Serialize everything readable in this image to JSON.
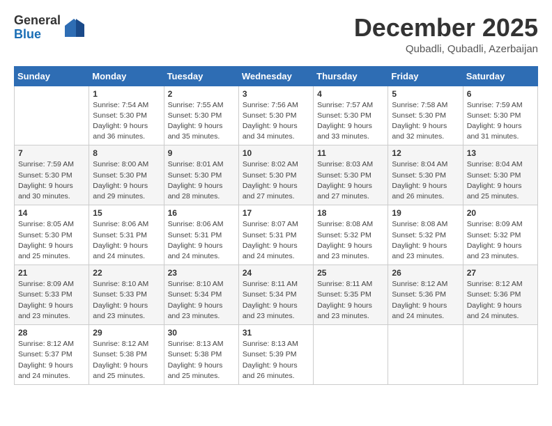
{
  "logo": {
    "general": "General",
    "blue": "Blue"
  },
  "title": {
    "month_year": "December 2025",
    "location": "Qubadli, Qubadli, Azerbaijan"
  },
  "headers": [
    "Sunday",
    "Monday",
    "Tuesday",
    "Wednesday",
    "Thursday",
    "Friday",
    "Saturday"
  ],
  "weeks": [
    [
      {
        "day": "",
        "sunrise": "",
        "sunset": "",
        "daylight": ""
      },
      {
        "day": "1",
        "sunrise": "Sunrise: 7:54 AM",
        "sunset": "Sunset: 5:30 PM",
        "daylight": "Daylight: 9 hours and 36 minutes."
      },
      {
        "day": "2",
        "sunrise": "Sunrise: 7:55 AM",
        "sunset": "Sunset: 5:30 PM",
        "daylight": "Daylight: 9 hours and 35 minutes."
      },
      {
        "day": "3",
        "sunrise": "Sunrise: 7:56 AM",
        "sunset": "Sunset: 5:30 PM",
        "daylight": "Daylight: 9 hours and 34 minutes."
      },
      {
        "day": "4",
        "sunrise": "Sunrise: 7:57 AM",
        "sunset": "Sunset: 5:30 PM",
        "daylight": "Daylight: 9 hours and 33 minutes."
      },
      {
        "day": "5",
        "sunrise": "Sunrise: 7:58 AM",
        "sunset": "Sunset: 5:30 PM",
        "daylight": "Daylight: 9 hours and 32 minutes."
      },
      {
        "day": "6",
        "sunrise": "Sunrise: 7:59 AM",
        "sunset": "Sunset: 5:30 PM",
        "daylight": "Daylight: 9 hours and 31 minutes."
      }
    ],
    [
      {
        "day": "7",
        "sunrise": "Sunrise: 7:59 AM",
        "sunset": "Sunset: 5:30 PM",
        "daylight": "Daylight: 9 hours and 30 minutes."
      },
      {
        "day": "8",
        "sunrise": "Sunrise: 8:00 AM",
        "sunset": "Sunset: 5:30 PM",
        "daylight": "Daylight: 9 hours and 29 minutes."
      },
      {
        "day": "9",
        "sunrise": "Sunrise: 8:01 AM",
        "sunset": "Sunset: 5:30 PM",
        "daylight": "Daylight: 9 hours and 28 minutes."
      },
      {
        "day": "10",
        "sunrise": "Sunrise: 8:02 AM",
        "sunset": "Sunset: 5:30 PM",
        "daylight": "Daylight: 9 hours and 27 minutes."
      },
      {
        "day": "11",
        "sunrise": "Sunrise: 8:03 AM",
        "sunset": "Sunset: 5:30 PM",
        "daylight": "Daylight: 9 hours and 27 minutes."
      },
      {
        "day": "12",
        "sunrise": "Sunrise: 8:04 AM",
        "sunset": "Sunset: 5:30 PM",
        "daylight": "Daylight: 9 hours and 26 minutes."
      },
      {
        "day": "13",
        "sunrise": "Sunrise: 8:04 AM",
        "sunset": "Sunset: 5:30 PM",
        "daylight": "Daylight: 9 hours and 25 minutes."
      }
    ],
    [
      {
        "day": "14",
        "sunrise": "Sunrise: 8:05 AM",
        "sunset": "Sunset: 5:30 PM",
        "daylight": "Daylight: 9 hours and 25 minutes."
      },
      {
        "day": "15",
        "sunrise": "Sunrise: 8:06 AM",
        "sunset": "Sunset: 5:31 PM",
        "daylight": "Daylight: 9 hours and 24 minutes."
      },
      {
        "day": "16",
        "sunrise": "Sunrise: 8:06 AM",
        "sunset": "Sunset: 5:31 PM",
        "daylight": "Daylight: 9 hours and 24 minutes."
      },
      {
        "day": "17",
        "sunrise": "Sunrise: 8:07 AM",
        "sunset": "Sunset: 5:31 PM",
        "daylight": "Daylight: 9 hours and 24 minutes."
      },
      {
        "day": "18",
        "sunrise": "Sunrise: 8:08 AM",
        "sunset": "Sunset: 5:32 PM",
        "daylight": "Daylight: 9 hours and 23 minutes."
      },
      {
        "day": "19",
        "sunrise": "Sunrise: 8:08 AM",
        "sunset": "Sunset: 5:32 PM",
        "daylight": "Daylight: 9 hours and 23 minutes."
      },
      {
        "day": "20",
        "sunrise": "Sunrise: 8:09 AM",
        "sunset": "Sunset: 5:32 PM",
        "daylight": "Daylight: 9 hours and 23 minutes."
      }
    ],
    [
      {
        "day": "21",
        "sunrise": "Sunrise: 8:09 AM",
        "sunset": "Sunset: 5:33 PM",
        "daylight": "Daylight: 9 hours and 23 minutes."
      },
      {
        "day": "22",
        "sunrise": "Sunrise: 8:10 AM",
        "sunset": "Sunset: 5:33 PM",
        "daylight": "Daylight: 9 hours and 23 minutes."
      },
      {
        "day": "23",
        "sunrise": "Sunrise: 8:10 AM",
        "sunset": "Sunset: 5:34 PM",
        "daylight": "Daylight: 9 hours and 23 minutes."
      },
      {
        "day": "24",
        "sunrise": "Sunrise: 8:11 AM",
        "sunset": "Sunset: 5:34 PM",
        "daylight": "Daylight: 9 hours and 23 minutes."
      },
      {
        "day": "25",
        "sunrise": "Sunrise: 8:11 AM",
        "sunset": "Sunset: 5:35 PM",
        "daylight": "Daylight: 9 hours and 23 minutes."
      },
      {
        "day": "26",
        "sunrise": "Sunrise: 8:12 AM",
        "sunset": "Sunset: 5:36 PM",
        "daylight": "Daylight: 9 hours and 24 minutes."
      },
      {
        "day": "27",
        "sunrise": "Sunrise: 8:12 AM",
        "sunset": "Sunset: 5:36 PM",
        "daylight": "Daylight: 9 hours and 24 minutes."
      }
    ],
    [
      {
        "day": "28",
        "sunrise": "Sunrise: 8:12 AM",
        "sunset": "Sunset: 5:37 PM",
        "daylight": "Daylight: 9 hours and 24 minutes."
      },
      {
        "day": "29",
        "sunrise": "Sunrise: 8:12 AM",
        "sunset": "Sunset: 5:38 PM",
        "daylight": "Daylight: 9 hours and 25 minutes."
      },
      {
        "day": "30",
        "sunrise": "Sunrise: 8:13 AM",
        "sunset": "Sunset: 5:38 PM",
        "daylight": "Daylight: 9 hours and 25 minutes."
      },
      {
        "day": "31",
        "sunrise": "Sunrise: 8:13 AM",
        "sunset": "Sunset: 5:39 PM",
        "daylight": "Daylight: 9 hours and 26 minutes."
      },
      {
        "day": "",
        "sunrise": "",
        "sunset": "",
        "daylight": ""
      },
      {
        "day": "",
        "sunrise": "",
        "sunset": "",
        "daylight": ""
      },
      {
        "day": "",
        "sunrise": "",
        "sunset": "",
        "daylight": ""
      }
    ]
  ]
}
